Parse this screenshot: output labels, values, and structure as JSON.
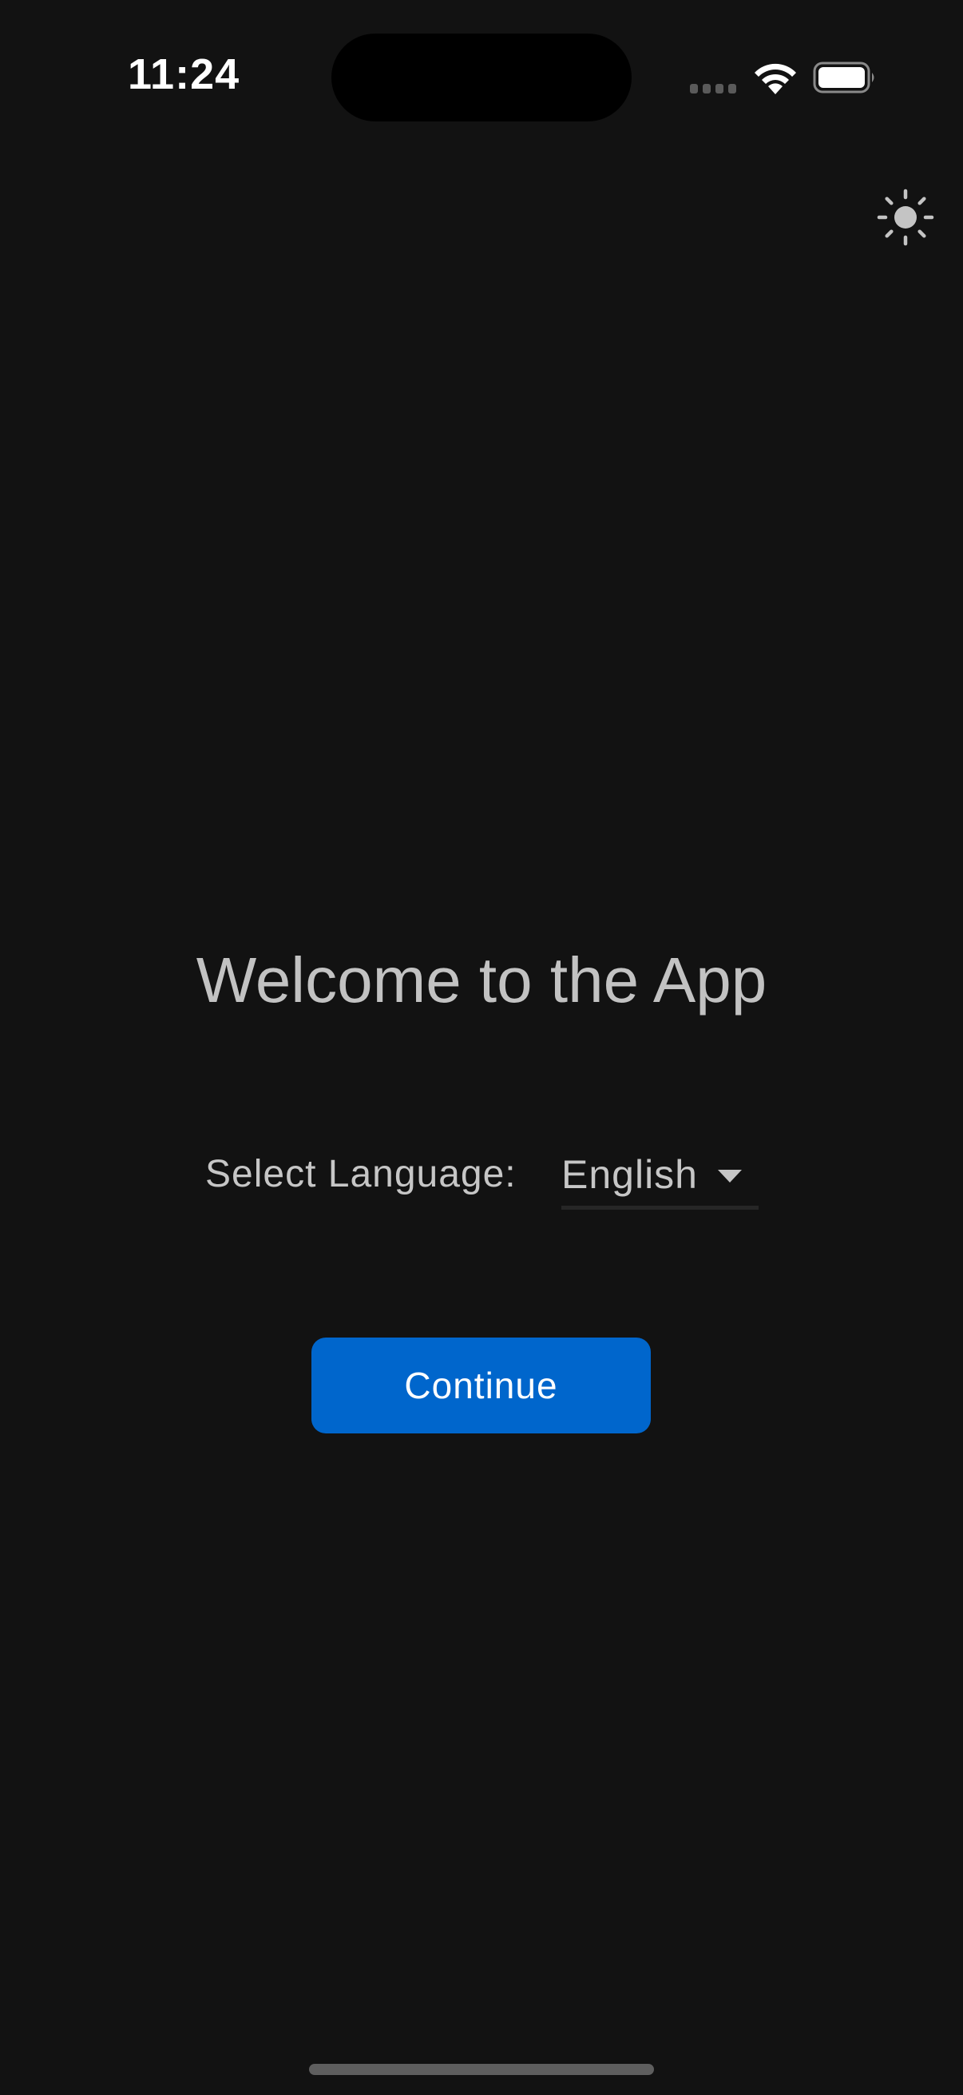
{
  "status_bar": {
    "time": "11:24",
    "icons": [
      "signal-icon",
      "wifi-icon",
      "battery-icon"
    ]
  },
  "header": {
    "theme_toggle_icon": "sun-icon"
  },
  "main": {
    "title": "Welcome to the App",
    "language": {
      "label": "Select Language:",
      "selected": "English"
    },
    "continue_label": "Continue"
  },
  "colors": {
    "background": "#121212",
    "accent": "#0066cc",
    "text": "#c2c2c2"
  }
}
